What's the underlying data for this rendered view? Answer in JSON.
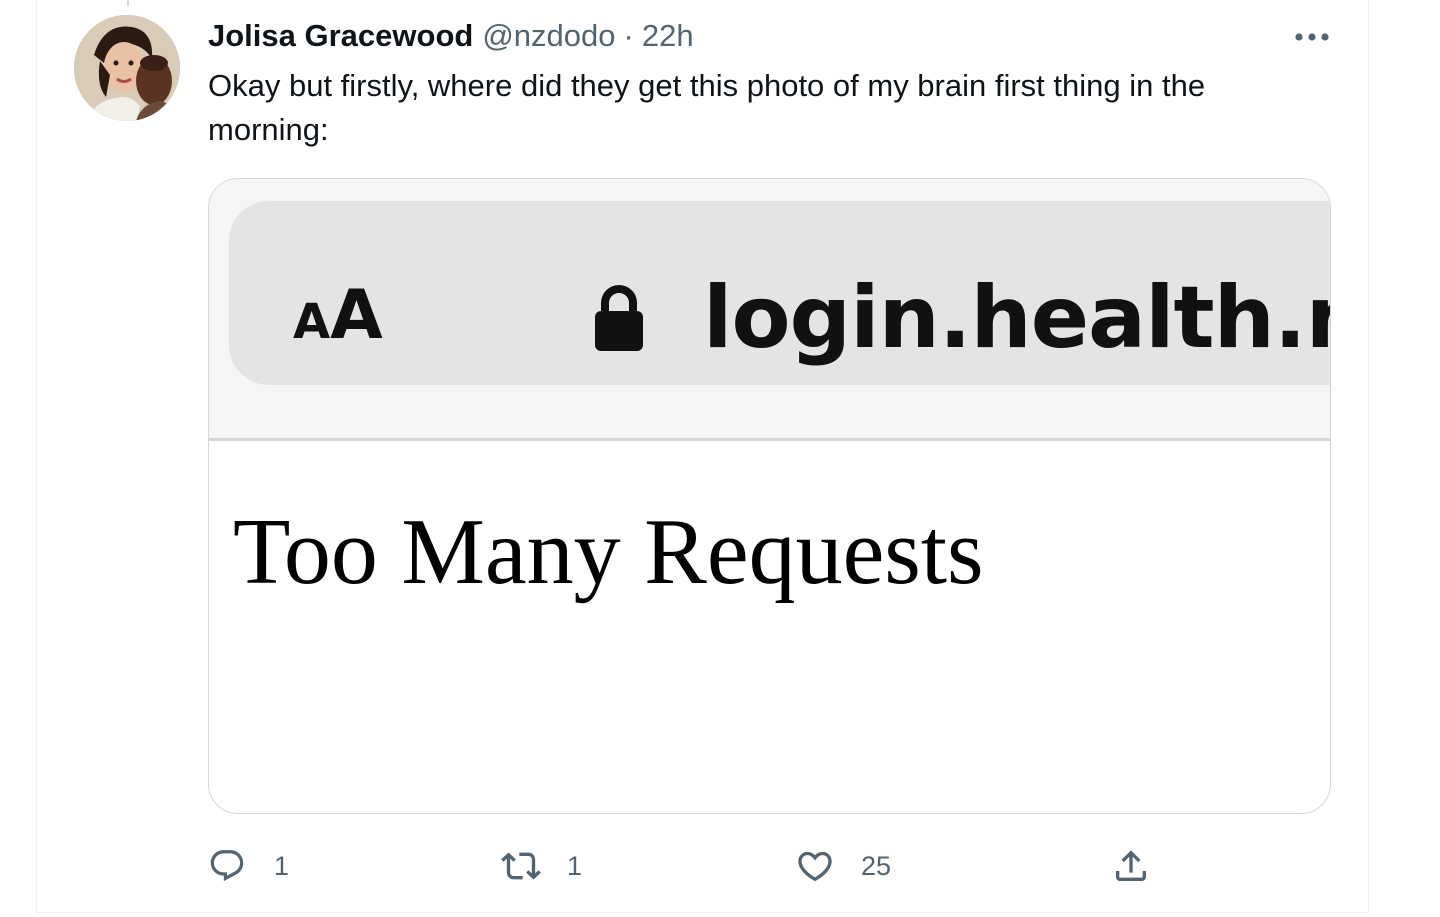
{
  "tweet": {
    "display_name": "Jolisa Gracewood",
    "handle": "@nzdodo",
    "separator": "·",
    "time": "22h",
    "text": "Okay but firstly, where did they get this photo of my brain first thing in the morning:",
    "more_icon": "ellipsis-icon",
    "avatar": "avatar-photo"
  },
  "media": {
    "browser_bar": {
      "text_size_label_small": "A",
      "text_size_label_large": "A",
      "lock_icon": "lock-icon",
      "url": "login.health.nz"
    },
    "page_heading": "Too Many Requests"
  },
  "actions": {
    "reply": {
      "icon": "reply-icon",
      "count": "1"
    },
    "retweet": {
      "icon": "retweet-icon",
      "count": "1"
    },
    "like": {
      "icon": "heart-icon",
      "count": "25"
    },
    "share": {
      "icon": "share-icon"
    }
  },
  "colors": {
    "text_primary": "#0f1419",
    "text_secondary": "#536471",
    "border": "#cfd9de",
    "url_pill": "#e4e4e4"
  }
}
